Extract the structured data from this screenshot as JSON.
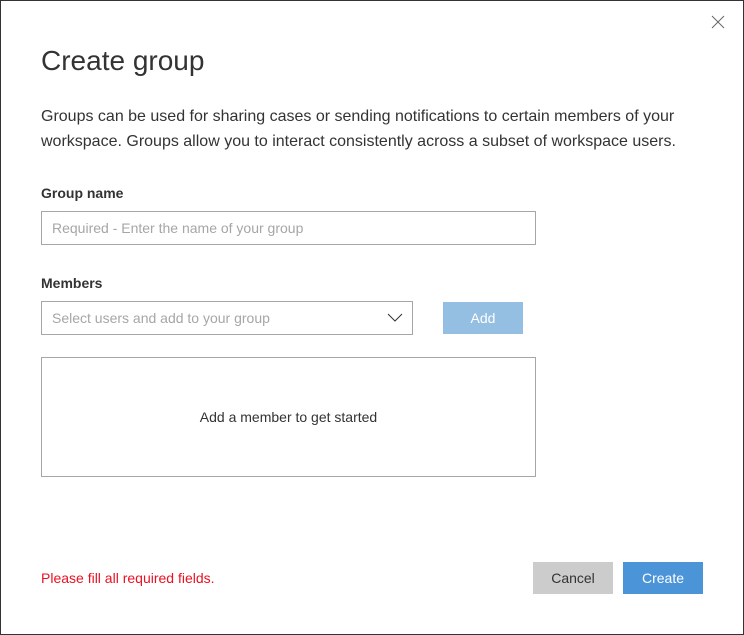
{
  "dialog": {
    "title": "Create group",
    "description": "Groups can be used for sharing cases or sending notifications to certain members of your workspace. Groups allow you to interact consistently across a subset of workspace users."
  },
  "groupName": {
    "label": "Group name",
    "placeholder": "Required - Enter the name of your group",
    "value": ""
  },
  "members": {
    "label": "Members",
    "selectPlaceholder": "Select users and add to your group",
    "addButton": "Add",
    "emptyText": "Add a member to get started"
  },
  "footer": {
    "errorText": "Please fill all required fields.",
    "cancelButton": "Cancel",
    "createButton": "Create"
  }
}
